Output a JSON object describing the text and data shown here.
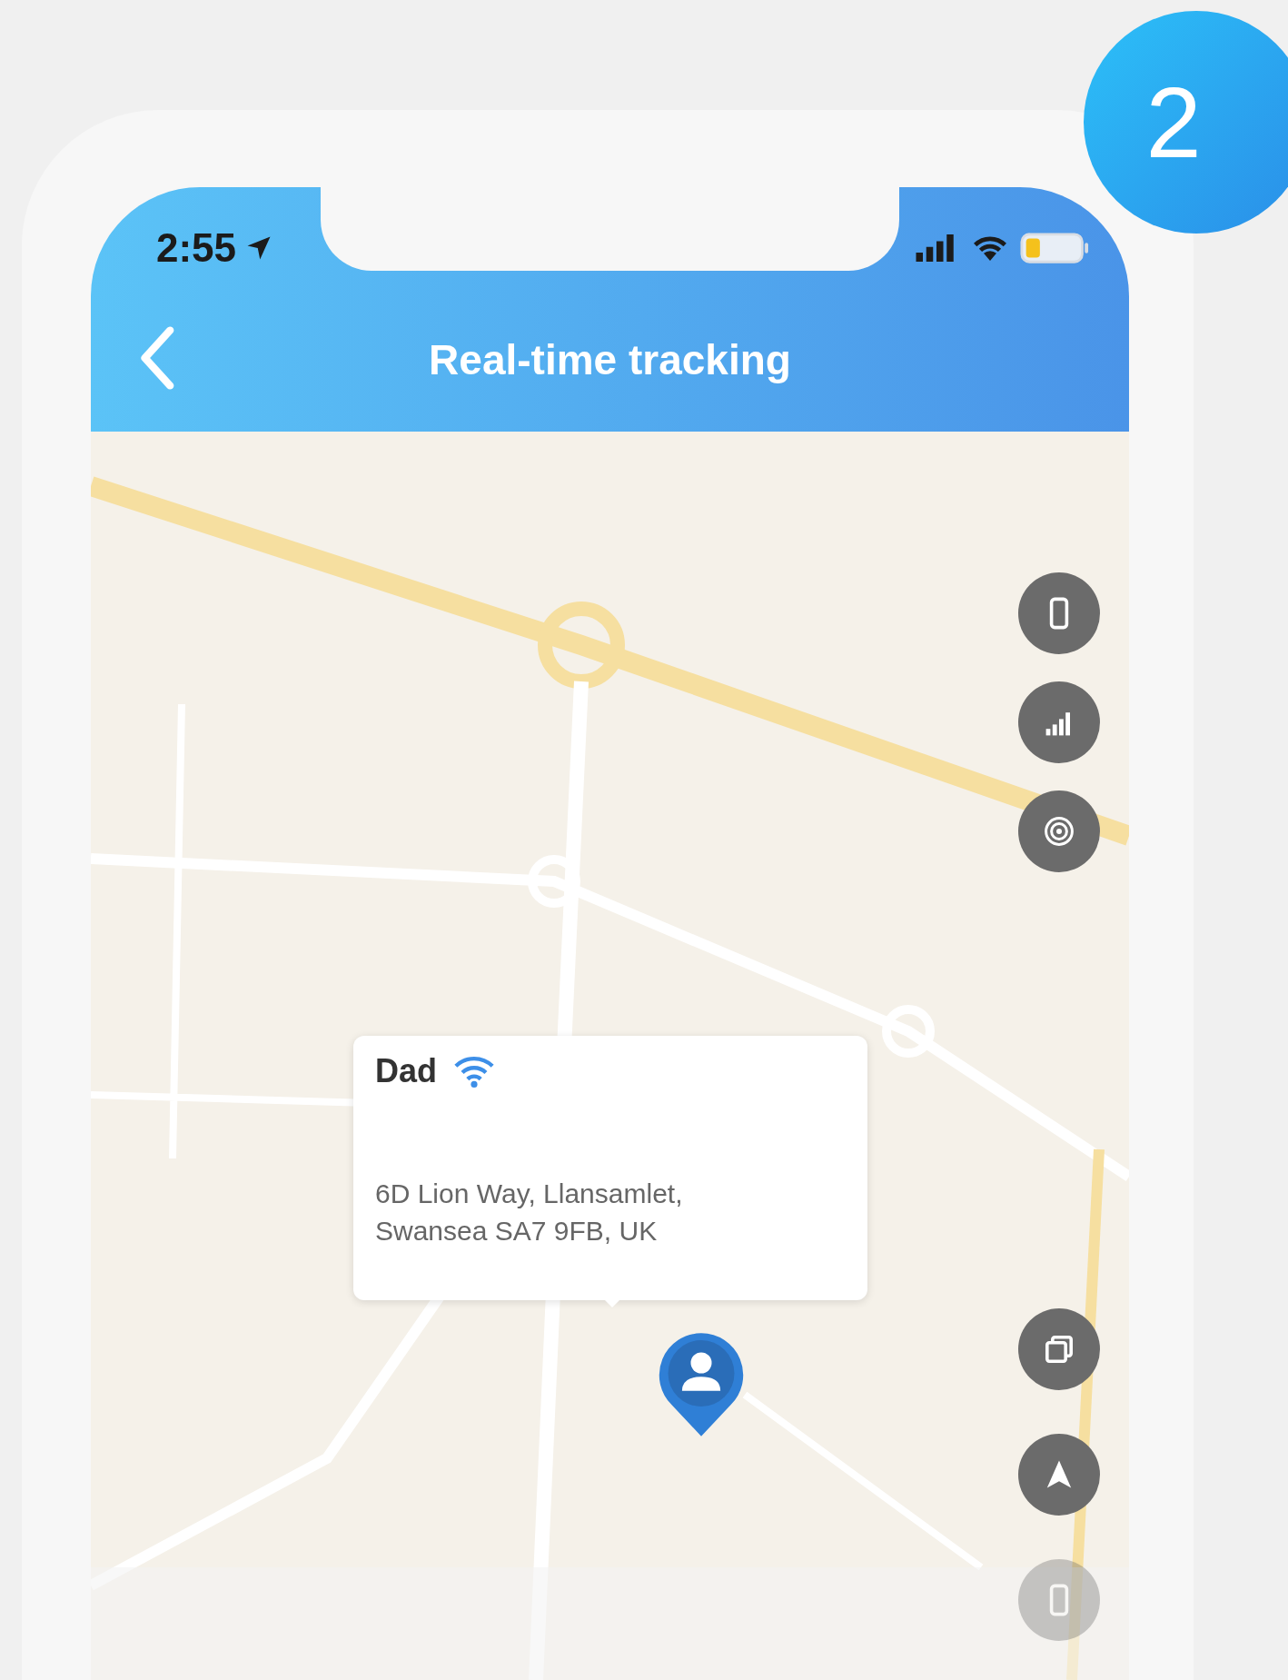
{
  "badge": "2",
  "status_bar": {
    "time": "2:55"
  },
  "header": {
    "title": "Real-time tracking"
  },
  "popup": {
    "name": "Dad",
    "address": "6D Lion Way, Llansamlet, Swansea SA7 9FB, UK"
  }
}
